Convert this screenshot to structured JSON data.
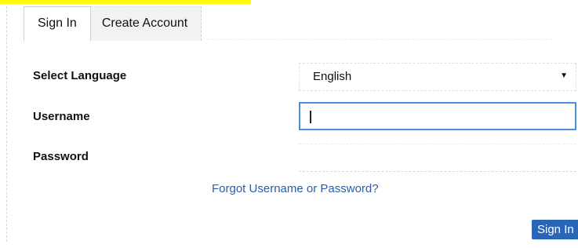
{
  "tabs": [
    {
      "label": "Sign In",
      "active": true
    },
    {
      "label": "Create Account",
      "active": false
    }
  ],
  "form": {
    "language": {
      "label": "Select Language",
      "selected": "English",
      "arrow_icon": "caret-down-icon"
    },
    "username": {
      "label": "Username",
      "value": ""
    },
    "password": {
      "label": "Password",
      "value": ""
    },
    "forgot_link": "Forgot Username or Password?",
    "submit_label": "Sign In"
  },
  "colors": {
    "highlight": "#ffff00",
    "focus_border": "#4a90d9",
    "link": "#2a5ea6",
    "button_bg": "#2a66b8"
  }
}
